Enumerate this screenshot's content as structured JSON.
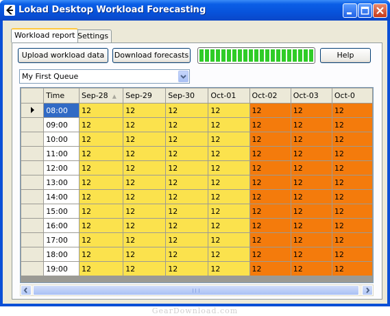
{
  "window": {
    "title": "Lokad Desktop Workload Forecasting"
  },
  "tabs": [
    {
      "label": "Workload report",
      "active": true
    },
    {
      "label": "Settings",
      "active": false
    }
  ],
  "toolbar": {
    "upload_label": "Upload workload data",
    "download_label": "Download forecasts",
    "help_label": "Help",
    "progress_value": 1.0
  },
  "queue_select": {
    "value": "My First Queue"
  },
  "grid": {
    "columns": [
      "Time",
      "Sep-28",
      "Sep-29",
      "Sep-30",
      "Oct-01",
      "Oct-02",
      "Oct-03",
      "Oct-0"
    ],
    "sorted_column": "Sep-28",
    "column_colors": [
      "#ffffff",
      "#fbe24d",
      "#fbe24d",
      "#fbe24d",
      "#fbe24d",
      "#f47b0c",
      "#f47b0c",
      "#f47b0c"
    ],
    "rows": [
      {
        "time": "08:00",
        "values": [
          "12",
          "12",
          "12",
          "12",
          "12",
          "12",
          "12"
        ],
        "current": true
      },
      {
        "time": "09:00",
        "values": [
          "12",
          "12",
          "12",
          "12",
          "12",
          "12",
          "12"
        ]
      },
      {
        "time": "10:00",
        "values": [
          "12",
          "12",
          "12",
          "12",
          "12",
          "12",
          "12"
        ]
      },
      {
        "time": "11:00",
        "values": [
          "12",
          "12",
          "12",
          "12",
          "12",
          "12",
          "12"
        ]
      },
      {
        "time": "12:00",
        "values": [
          "12",
          "12",
          "12",
          "12",
          "12",
          "12",
          "12"
        ]
      },
      {
        "time": "13:00",
        "values": [
          "12",
          "12",
          "12",
          "12",
          "12",
          "12",
          "12"
        ]
      },
      {
        "time": "14:00",
        "values": [
          "12",
          "12",
          "12",
          "12",
          "12",
          "12",
          "12"
        ]
      },
      {
        "time": "15:00",
        "values": [
          "12",
          "12",
          "12",
          "12",
          "12",
          "12",
          "12"
        ]
      },
      {
        "time": "16:00",
        "values": [
          "12",
          "12",
          "12",
          "12",
          "12",
          "12",
          "12"
        ]
      },
      {
        "time": "17:00",
        "values": [
          "12",
          "12",
          "12",
          "12",
          "12",
          "12",
          "12"
        ]
      },
      {
        "time": "18:00",
        "values": [
          "12",
          "12",
          "12",
          "12",
          "12",
          "12",
          "12"
        ]
      },
      {
        "time": "19:00",
        "values": [
          "12",
          "12",
          "12",
          "12",
          "12",
          "12",
          "12"
        ]
      }
    ]
  },
  "watermark": "GearDownload.com"
}
